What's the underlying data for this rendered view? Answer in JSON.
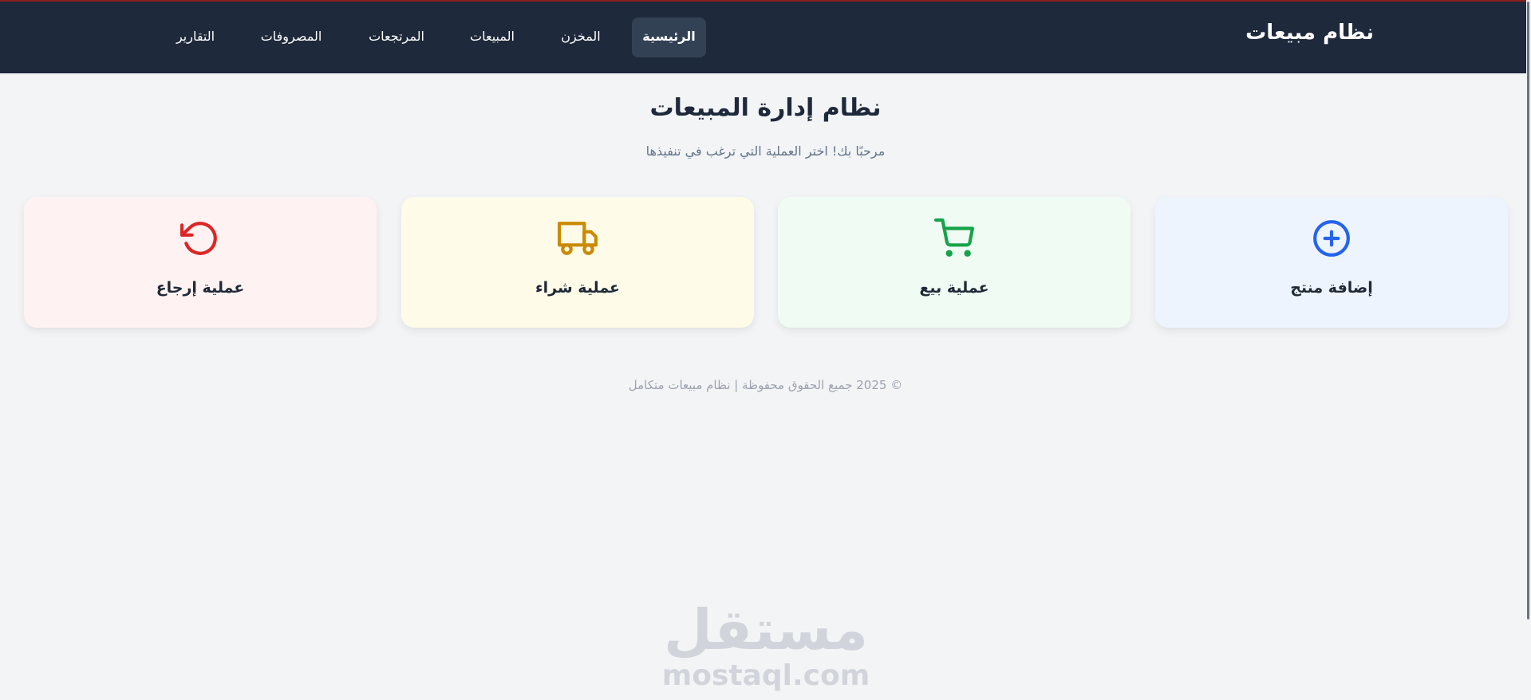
{
  "brand": "نظام مبيعات",
  "nav": [
    {
      "label": "الرئيسية",
      "active": true
    },
    {
      "label": "المخزن",
      "active": false
    },
    {
      "label": "المبيعات",
      "active": false
    },
    {
      "label": "المرتجعات",
      "active": false
    },
    {
      "label": "المصروفات",
      "active": false
    },
    {
      "label": "التقارير",
      "active": false
    }
  ],
  "main": {
    "title": "نظام إدارة المبيعات",
    "subtitle": "مرحبًا بك! اختر العملية التي ترغب في تنفيذها"
  },
  "cards": [
    {
      "label": "إضافة منتج",
      "icon": "plus-circle-icon",
      "bg": "#eef4fe",
      "color": "#2563eb"
    },
    {
      "label": "عملية بيع",
      "icon": "shopping-cart-icon",
      "bg": "#effbf3",
      "color": "#16a34a"
    },
    {
      "label": "عملية شراء",
      "icon": "truck-icon",
      "bg": "#fefbe8",
      "color": "#ca8a04"
    },
    {
      "label": "عملية إرجاع",
      "icon": "rotate-ccw-icon",
      "bg": "#fef2f2",
      "color": "#dc2626"
    }
  ],
  "footer": "© 2025 جميع الحقوق محفوظة | نظام مبيعات متكامل",
  "watermark": {
    "arabic": "مستقل",
    "latin": "mostaql.com"
  },
  "colors": {
    "navbar": "#1e293b",
    "nav_active": "#334155",
    "page_bg": "#f3f4f6"
  }
}
